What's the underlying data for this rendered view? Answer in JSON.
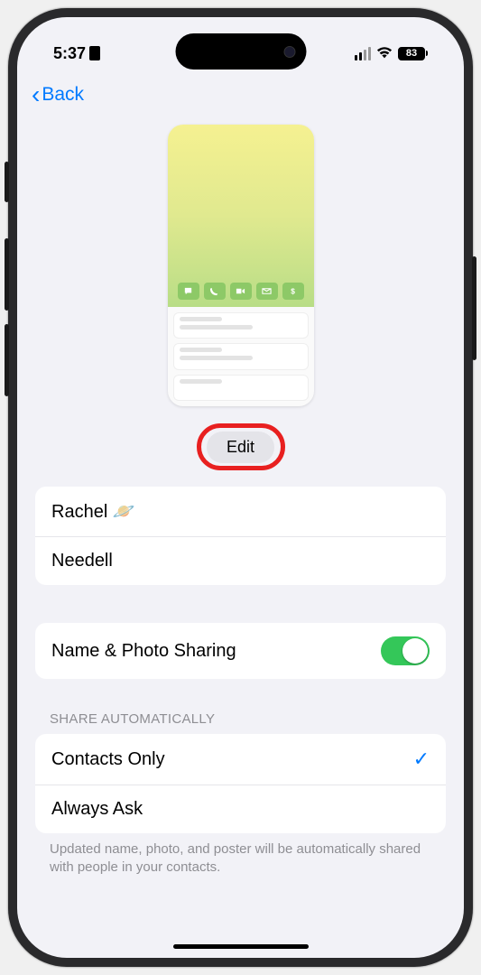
{
  "status": {
    "time": "5:37",
    "battery": "83"
  },
  "nav": {
    "back_label": "Back"
  },
  "edit": {
    "label": "Edit"
  },
  "name": {
    "first": "Rachel 🪐",
    "last": "Needell"
  },
  "sharing": {
    "label": "Name & Photo Sharing"
  },
  "share_auto": {
    "header": "SHARE AUTOMATICALLY",
    "options": [
      {
        "label": "Contacts Only",
        "selected": true
      },
      {
        "label": "Always Ask",
        "selected": false
      }
    ],
    "footer": "Updated name, photo, and poster will be automatically shared with people in your contacts."
  }
}
